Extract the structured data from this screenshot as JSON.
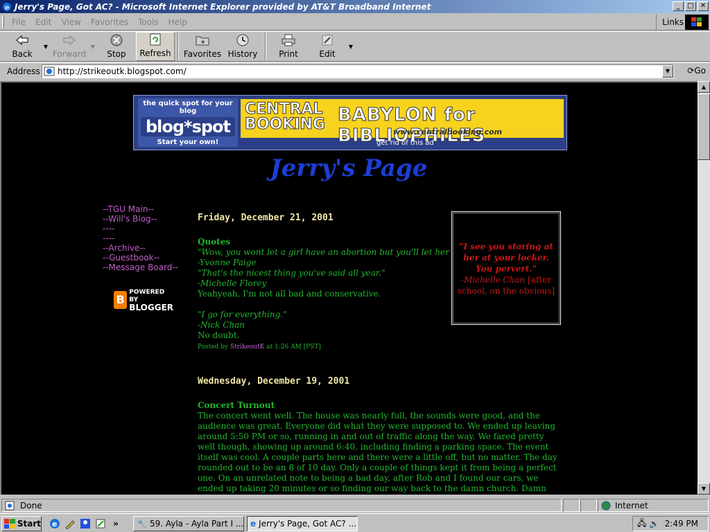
{
  "window": {
    "title": "Jerry's Page, Got AC? - Microsoft Internet Explorer provided by AT&T Broadband Internet",
    "min": "_",
    "max": "□",
    "close": "✕"
  },
  "menu": {
    "items": [
      "File",
      "Edit",
      "View",
      "Favorites",
      "Tools",
      "Help"
    ],
    "links": "Links"
  },
  "toolbar": {
    "back": "Back",
    "forward": "Forward",
    "stop": "Stop",
    "refresh": "Refresh",
    "favorites": "Favorites",
    "history": "History",
    "print": "Print",
    "edit": "Edit"
  },
  "address": {
    "label": "Address",
    "url": "http://strikeoutk.blogspot.com/",
    "go": "Go"
  },
  "ad": {
    "bs_tag": "the quick spot for your blog",
    "bs_logo": "blog*spot",
    "bs_cta": "Start your own!",
    "cb_logo_1": "CENTRAL",
    "cb_logo_2": "BOOKING",
    "cb_slogan": "BABYLON for BIBLIOPHILES",
    "cb_url": "www.centralbooking.com",
    "remove": "get rid of this ad"
  },
  "page": {
    "title": "Jerry's Page"
  },
  "sidebar": {
    "links": [
      "--TGU Main--",
      "--Will's Blog--",
      "----",
      "----",
      "--Archive--",
      "--Guestbook--",
      "--Message Board--"
    ],
    "powered_1": "POWERED BY",
    "powered_2": "BLOGGER",
    "powered_icon": "B"
  },
  "posts": [
    {
      "date": "Friday, December 21, 2001",
      "title": "Quotes",
      "lines": [
        "\"Wow, you wont let a girl have an abortion but you'll let her get pizza first.\"",
        "-Yvonne Paige",
        "\"That's the nicest thing you've said all year.\"",
        "-Michelle Florey",
        "Yeahyeah, I'm not all bad and conservative."
      ],
      "lines2": [
        "\"I go for everything.\"",
        "-Nick Chan",
        "No doubt."
      ],
      "footer_prefix": "Posted by",
      "footer_author": "StrikeoutK",
      "footer_suffix": "at 1:26 AM [PST]"
    },
    {
      "date": "Wednesday, December 19, 2001",
      "title": "Concert Turnout",
      "body": "The concert went well. The house was nearly full, the sounds were good, and the audience was great. Everyone did what they were supposed to. We ended up leaving around 5:50 PM or so, running in and out of traffic along the way. We fared pretty well though, showing up around 6:40, including finding a parking space. The event itself was cool. A couple parts here and there were a little off, but no matter. The day rounded out to be an 8 of 10 day. Only a couple of things kept it from being a perfect one. On an unrelated note to being a bad day, after Rob and I found our cars, we ended up taking 20 minutes or so finding our way back to the damn church. Damn Berkeley and"
    }
  ],
  "quotebox": {
    "quote": "\"I see you staring at her at your locker. You pervert.\"",
    "who": "-Michelle Chan",
    "note": "[after school, on the obvious]"
  },
  "status": {
    "text": "Done",
    "zone": "Internet"
  },
  "taskbar": {
    "start": "Start",
    "items": [
      "59. Ayla - Ayla Part I ...",
      "Jerry's Page, Got AC? ..."
    ],
    "clock": "2:49 PM"
  },
  "colors": {
    "post_text": "#22b52f",
    "link": "#c060c8",
    "date": "#f0e6a8",
    "title": "#1c3ed6",
    "quote": "#c81818"
  }
}
